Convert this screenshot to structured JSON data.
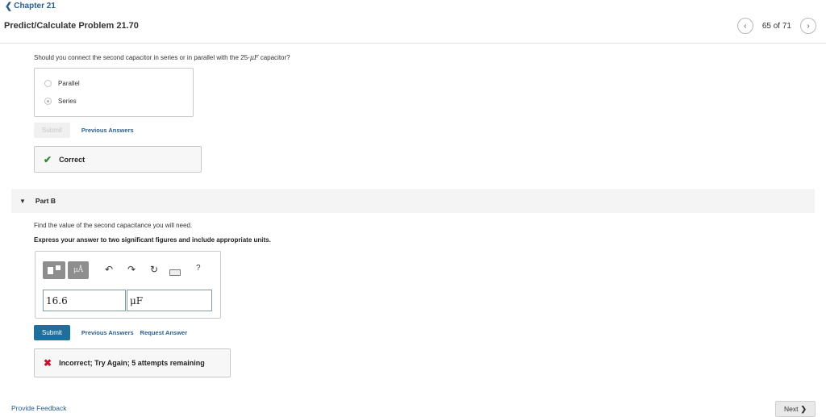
{
  "header": {
    "back_label": "Chapter 21",
    "problem_title": "Predict/Calculate Problem 21.70",
    "pager_text": "65 of 71"
  },
  "part_a": {
    "question_prefix": "Should you connect the second capacitor in series or in parallel with the 25-",
    "question_unit": "μF",
    "question_suffix": " capacitor?",
    "options": [
      {
        "label": "Parallel",
        "selected": false
      },
      {
        "label": "Series",
        "selected": true
      }
    ],
    "submit_label": "Submit",
    "previous_answers_label": "Previous Answers",
    "feedback": {
      "text": "Correct",
      "status": "correct",
      "color": "#2e8b2e"
    }
  },
  "part_b": {
    "label": "Part B",
    "question": "Find the value of the second capacitance you will need.",
    "instruction": "Express your answer to two significant figures and include appropriate units.",
    "toolbar": {
      "units_label": "μÅ",
      "help_label": "?"
    },
    "value_field": "16.6",
    "unit_field": "μF",
    "submit_label": "Submit",
    "previous_answers_label": "Previous Answers",
    "request_answer_label": "Request Answer",
    "feedback": {
      "text": "Incorrect; Try Again; 5 attempts remaining",
      "status": "incorrect",
      "color": "#c8102e"
    }
  },
  "footer": {
    "provide_feedback_label": "Provide Feedback",
    "next_label": "Next"
  },
  "colors": {
    "link": "#2a5e8c",
    "submit_active": "#1f6f9c"
  }
}
